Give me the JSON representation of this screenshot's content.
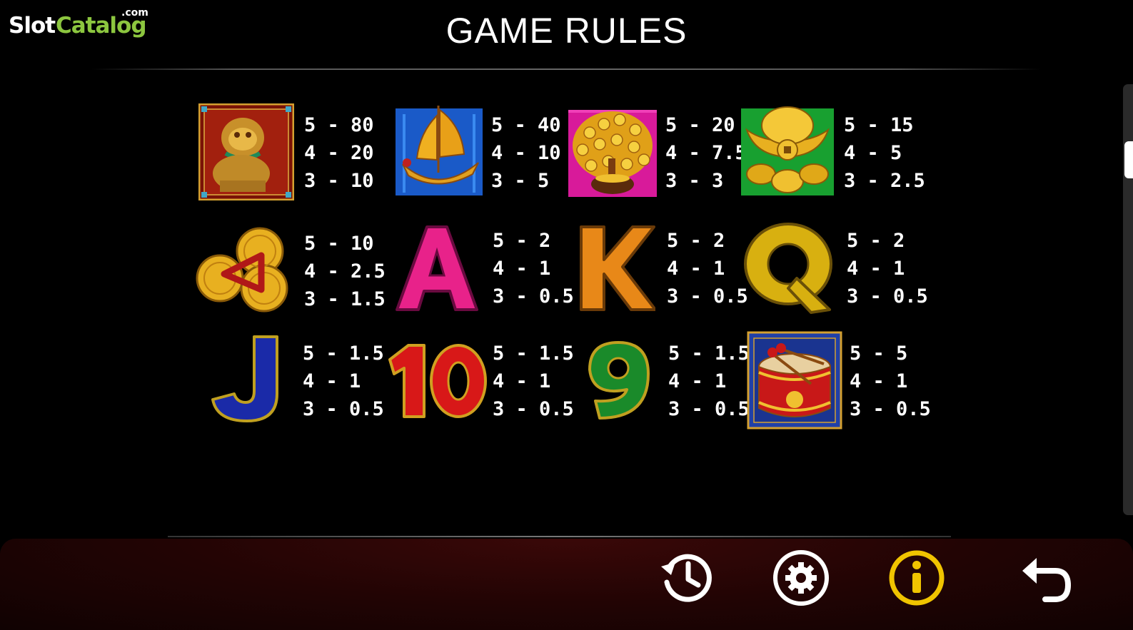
{
  "logo": {
    "slot": "Slot",
    "catalog": "Catalog",
    "com": ".com"
  },
  "title": "GAME RULES",
  "paytable": [
    {
      "symbol": "golden-lion-icon",
      "lines": [
        "5 - 80",
        "4 - 20",
        "3 - 10"
      ]
    },
    {
      "symbol": "junk-ship-icon",
      "lines": [
        "5 - 40",
        "4 - 10",
        "3 - 5"
      ]
    },
    {
      "symbol": "money-tree-icon",
      "lines": [
        "5 - 20",
        "4 - 7.5",
        "3 - 3"
      ]
    },
    {
      "symbol": "gold-ingot-icon",
      "lines": [
        "5 - 15",
        "4 - 5",
        "3 - 2.5"
      ]
    },
    {
      "symbol": "coins-icon",
      "lines": [
        "5 - 10",
        "4 - 2.5",
        "3 - 1.5"
      ]
    },
    {
      "symbol": "letter-a-icon",
      "glyph": "A",
      "lines": [
        "5 - 2",
        "4 - 1",
        "3 - 0.5"
      ]
    },
    {
      "symbol": "letter-k-icon",
      "glyph": "K",
      "lines": [
        "5 - 2",
        "4 - 1",
        "3 - 0.5"
      ]
    },
    {
      "symbol": "letter-q-icon",
      "glyph": "Q",
      "lines": [
        "5 - 2",
        "4 - 1",
        "3 - 0.5"
      ]
    },
    {
      "symbol": "letter-j-icon",
      "glyph": "J",
      "lines": [
        "5 - 1.5",
        "4 - 1",
        "3 - 0.5"
      ]
    },
    {
      "symbol": "number-10-icon",
      "glyph": "10",
      "lines": [
        "5 - 1.5",
        "4 - 1",
        "3 - 0.5"
      ]
    },
    {
      "symbol": "number-9-icon",
      "glyph": "9",
      "lines": [
        "5 - 1.5",
        "4 - 1",
        "3 - 0.5"
      ]
    },
    {
      "symbol": "drum-icon",
      "lines": [
        "5 - 5",
        "4 - 1",
        "3 - 0.5"
      ]
    }
  ],
  "controls": [
    {
      "name": "history-button",
      "icon": "history-icon"
    },
    {
      "name": "settings-button",
      "icon": "gear-icon"
    },
    {
      "name": "info-button",
      "icon": "info-icon",
      "active": true
    },
    {
      "name": "back-button",
      "icon": "back-arrow-icon"
    }
  ],
  "colors": {
    "accent": "#f0c400",
    "background": "#000000",
    "bar": "#2a0505"
  }
}
